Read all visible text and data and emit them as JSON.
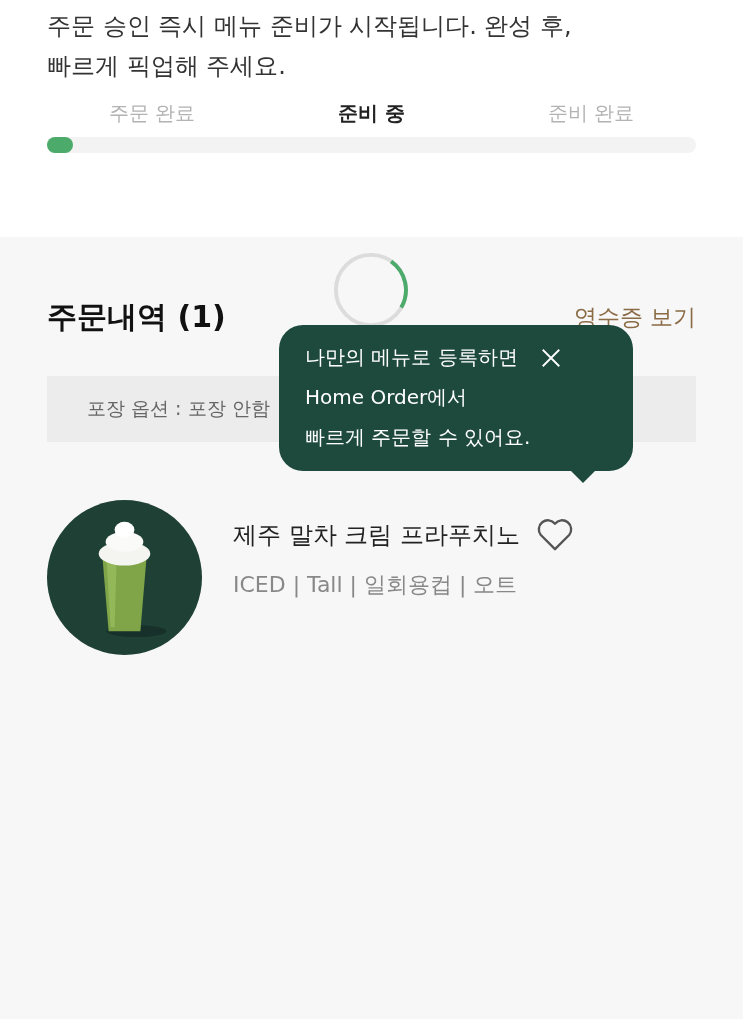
{
  "notice": "주문 승인 즉시 메뉴 준비가 시작됩니다. 완성 후,\n빠르게 픽업해 주세요.",
  "steps": [
    {
      "label": "주문 완료",
      "selected": false
    },
    {
      "label": "준비 중",
      "selected": true
    },
    {
      "label": "준비 완료",
      "selected": false
    }
  ],
  "progress": {
    "level": 0.04
  },
  "order": {
    "title": "주문내역 (1)",
    "receipt_link": "영수증 보기",
    "packaging": "포장 옵션 : 포장 안함",
    "items": [
      {
        "name": "제주 말차 크림 프라푸치노",
        "options": "ICED | Tall | 일회용컵 | 오트",
        "favorite": false
      }
    ]
  },
  "tooltip": {
    "lines": [
      "나만의 메뉴로 등록하면",
      "Home Order에서",
      "빠르게 주문할 수 있어요."
    ]
  }
}
